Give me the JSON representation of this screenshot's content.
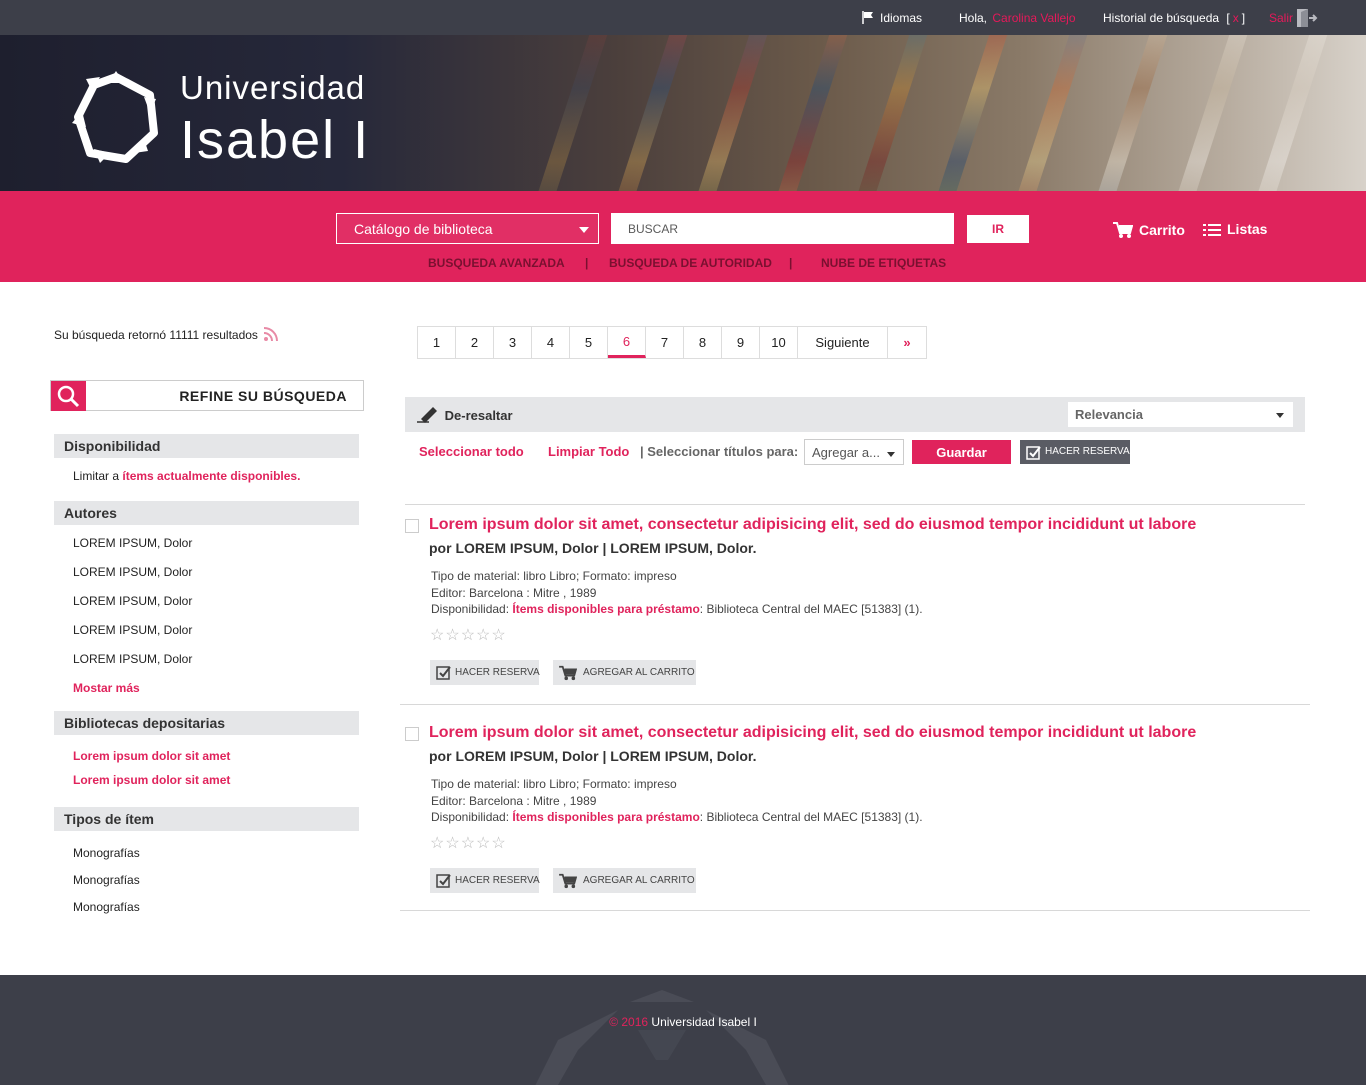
{
  "topbar": {
    "languages": "Idiomas",
    "greeting": "Hola,",
    "user": "Carolina Vallejo",
    "history": "Historial de búsqueda",
    "history_open": "[",
    "history_clear": "x",
    "history_close": "]",
    "logout": "Salir"
  },
  "brand": {
    "line1": "Universidad",
    "line2": "Isabel I"
  },
  "search": {
    "scope": "Catálogo de biblioteca",
    "placeholder": "BUSCAR",
    "go": "IR",
    "cart": "Carrito",
    "lists": "Listas",
    "links": [
      "BUSQUEDA AVANZADA",
      "BUSQUEDA DE AUTORIDAD",
      "NUBE DE ETIQUETAS"
    ],
    "separator": "|"
  },
  "sidebar": {
    "results_text": "Su búsqueda retornó 11111 resultados",
    "refine_title": "REFINE SU BÚSQUEDA",
    "availability": {
      "title": "Disponibilidad",
      "prefix": "Limitar a",
      "link": "ítems actualmente disponibles."
    },
    "authors": {
      "title": "Autores",
      "items": [
        "LOREM IPSUM, Dolor",
        "LOREM IPSUM, Dolor",
        "LOREM IPSUM, Dolor",
        "LOREM IPSUM, Dolor",
        "LOREM IPSUM, Dolor"
      ],
      "more": "Mostar más"
    },
    "libraries": {
      "title": "Bibliotecas depositarias",
      "items": [
        "Lorem ipsum dolor sit amet",
        "Lorem ipsum dolor sit amet"
      ]
    },
    "types": {
      "title": "Tipos de ítem",
      "items": [
        "Monografías",
        "Monografías",
        "Monografías"
      ]
    }
  },
  "pagination": {
    "pages": [
      "1",
      "2",
      "3",
      "4",
      "5",
      "6",
      "7",
      "8",
      "9",
      "10"
    ],
    "current": "6",
    "next": "Siguiente",
    "last": "»"
  },
  "toolbar": {
    "dehighlight": "De-resaltar",
    "sort": "Relevancia",
    "select_all": "Seleccionar todo",
    "clear_all": "Limpiar Todo",
    "select_titles": "| Seleccionar títulos para:",
    "add_to": "Agregar a...",
    "save": "Guardar",
    "reserve": "HACER RESERVA"
  },
  "results": [
    {
      "title": "Lorem ipsum dolor sit amet, consectetur adipisicing elit, sed do eiusmod tempor incididunt ut labore",
      "author": "por LOREM IPSUM, Dolor | LOREM IPSUM, Dolor.",
      "material": "Tipo de material: libro Libro; Formato: impreso",
      "publisher": "Editor: Barcelona : Mitre , 1989",
      "avail_label": "Disponibilidad:",
      "avail_link": "Ítems disponibles para préstamo",
      "avail_rest": ": Biblioteca Central del MAEC [51383] (1).",
      "stars": "☆☆☆☆☆",
      "reserve": "HACER RESERVA",
      "cart": "AGREGAR AL CARRITO"
    },
    {
      "title": "Lorem ipsum dolor sit amet, consectetur adipisicing elit, sed do eiusmod tempor incididunt ut labore",
      "author": "por LOREM IPSUM, Dolor | LOREM IPSUM, Dolor.",
      "material": "Tipo de material: libro Libro; Formato: impreso",
      "publisher": "Editor: Barcelona : Mitre , 1989",
      "avail_label": "Disponibilidad:",
      "avail_link": "Ítems disponibles para préstamo",
      "avail_rest": ": Biblioteca Central del MAEC [51383] (1).",
      "stars": "☆☆☆☆☆",
      "reserve": "HACER RESERVA",
      "cart": "AGREGAR AL CARRITO"
    }
  ],
  "footer": {
    "year": "© 2016",
    "org": "Universidad Isabel I"
  },
  "colors": {
    "accent": "#e0235c",
    "dark": "#3d3f49",
    "panel": "#e5e6e8"
  },
  "icons": [
    "flag-icon",
    "logout-icon",
    "cart-icon",
    "list-icon",
    "rss-icon",
    "search-icon",
    "pencil-icon",
    "check-icon"
  ]
}
